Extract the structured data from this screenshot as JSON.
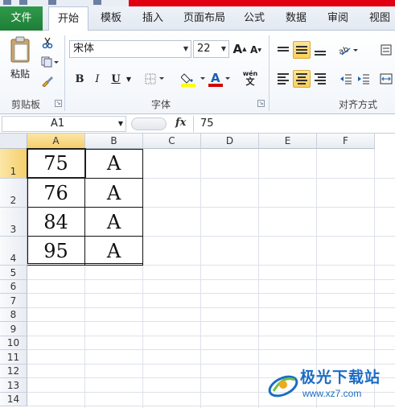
{
  "ribbon": {
    "tabs": [
      "文件",
      "开始",
      "模板",
      "插入",
      "页面布局",
      "公式",
      "数据",
      "审阅",
      "视图"
    ],
    "active_tab": "开始",
    "clipboard": {
      "paste_label": "粘贴",
      "group_label": "剪贴板"
    },
    "font": {
      "name": "宋体",
      "size": "22",
      "group_label": "字体",
      "bold": "B",
      "italic": "I",
      "underline": "U",
      "phonetic": "wén"
    },
    "alignment": {
      "group_label": "对齐方式"
    }
  },
  "formula_bar": {
    "name_box": "A1",
    "fx_label": "fx",
    "value": "75"
  },
  "sheet": {
    "columns": [
      "A",
      "B",
      "C",
      "D",
      "E",
      "F"
    ],
    "rows": [
      "1",
      "2",
      "3",
      "4",
      "5",
      "6",
      "7",
      "8",
      "9",
      "10",
      "11",
      "12",
      "13",
      "14"
    ],
    "cells": [
      [
        "75",
        "A"
      ],
      [
        "76",
        "A"
      ],
      [
        "84",
        "A"
      ],
      [
        "95",
        "A"
      ]
    ]
  },
  "watermark": {
    "title": "极光下载站",
    "url": "www.xz7.com"
  },
  "colors": {
    "file_tab": "#1e7e37",
    "title_red": "#e0000f",
    "selected_header": "#f5cf6b",
    "watermark": "#1b6cc4"
  }
}
